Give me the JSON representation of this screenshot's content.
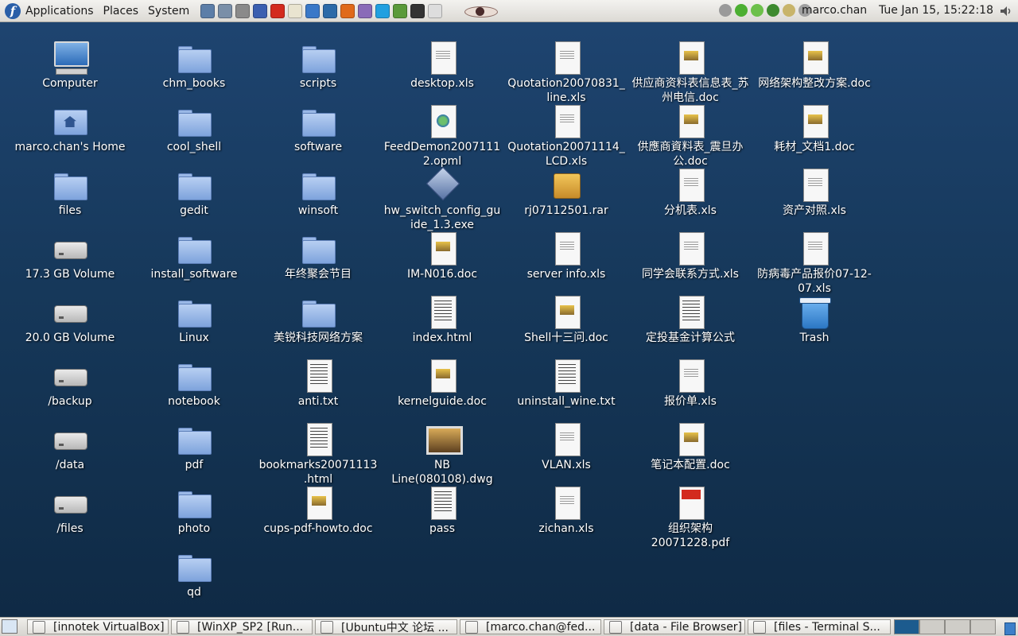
{
  "top_panel": {
    "menus": [
      "Applications",
      "Places",
      "System"
    ],
    "launchers": [
      {
        "icon": "monitor-icon",
        "color": "#5c7ea8"
      },
      {
        "icon": "network-icon",
        "color": "#7a8fa8"
      },
      {
        "icon": "server-icon",
        "color": "#8a8a8a"
      },
      {
        "icon": "globe-icon",
        "color": "#3b5fb0"
      },
      {
        "icon": "pdf-reader-icon",
        "color": "#d32a1e"
      },
      {
        "icon": "text-editor-icon",
        "color": "#e9e4d0"
      },
      {
        "icon": "chart-icon",
        "color": "#3a78c8"
      },
      {
        "icon": "thunderbird-icon",
        "color": "#2c6aa8"
      },
      {
        "icon": "firefox-icon",
        "color": "#e06a1a"
      },
      {
        "icon": "pidgin-icon",
        "color": "#8a6bb8"
      },
      {
        "icon": "skype-icon",
        "color": "#22a0e0"
      },
      {
        "icon": "dictionary-icon",
        "color": "#5a9a3a"
      },
      {
        "icon": "terminal-icon",
        "color": "#333333"
      },
      {
        "icon": "settings-icon",
        "color": "#dddddd"
      }
    ],
    "tray_icons": [
      {
        "icon": "mail-tray-icon",
        "color": "#9a9a9a"
      },
      {
        "icon": "chat-tray-icon",
        "color": "#4caf32"
      },
      {
        "icon": "status-tray-icon",
        "color": "#6cc04a"
      },
      {
        "icon": "update-tray-icon",
        "color": "#3d8a2f"
      },
      {
        "icon": "keyboard-tray-icon",
        "color": "#c8b46a"
      },
      {
        "icon": "battery-tray-icon",
        "color": "#a0a0a0"
      }
    ],
    "user": "marco.chan",
    "clock": "Tue Jan 15, 15:22:18"
  },
  "desktop": {
    "columns": [
      [
        {
          "label": "Computer",
          "type": "computer"
        },
        {
          "label": "marco.chan's Home",
          "type": "home"
        },
        {
          "label": "files",
          "type": "folder"
        },
        {
          "label": "17.3 GB Volume",
          "type": "drive"
        },
        {
          "label": "20.0 GB Volume",
          "type": "drive"
        },
        {
          "label": "/backup",
          "type": "drive"
        },
        {
          "label": "/data",
          "type": "drive"
        },
        {
          "label": "/files",
          "type": "drive"
        }
      ],
      [
        {
          "label": "chm_books",
          "type": "folder"
        },
        {
          "label": "cool_shell",
          "type": "folder"
        },
        {
          "label": "gedit",
          "type": "folder"
        },
        {
          "label": "install_software",
          "type": "folder"
        },
        {
          "label": "Linux",
          "type": "folder"
        },
        {
          "label": "notebook",
          "type": "folder"
        },
        {
          "label": "pdf",
          "type": "folder"
        },
        {
          "label": "photo",
          "type": "folder"
        },
        {
          "label": "qd",
          "type": "folder"
        }
      ],
      [
        {
          "label": "scripts",
          "type": "folder"
        },
        {
          "label": "software",
          "type": "folder"
        },
        {
          "label": "winsoft",
          "type": "folder"
        },
        {
          "label": "年终聚会节目",
          "type": "folder"
        },
        {
          "label": "美锐科技网络方案",
          "type": "folder"
        },
        {
          "label": "anti.txt",
          "type": "doc text"
        },
        {
          "label": "bookmarks20071113.html",
          "type": "doc text"
        },
        {
          "label": "cups-pdf-howto.doc",
          "type": "doc word"
        }
      ],
      [
        {
          "label": "desktop.xls",
          "type": "doc"
        },
        {
          "label": "FeedDemon20071112.opml",
          "type": "doc web"
        },
        {
          "label": "hw_switch_config_guide_1.3.exe",
          "type": "exe"
        },
        {
          "label": "IM-N016.doc",
          "type": "doc word"
        },
        {
          "label": "index.html",
          "type": "doc text"
        },
        {
          "label": "kernelguide.doc",
          "type": "doc word"
        },
        {
          "label": "NB Line(080108).dwg",
          "type": "imgfile"
        },
        {
          "label": "pass",
          "type": "doc text"
        }
      ],
      [
        {
          "label": "Quotation20070831_line.xls",
          "type": "doc"
        },
        {
          "label": "Quotation20071114_LCD.xls",
          "type": "doc"
        },
        {
          "label": "rj07112501.rar",
          "type": "archive"
        },
        {
          "label": "server info.xls",
          "type": "doc"
        },
        {
          "label": "Shell十三问.doc",
          "type": "doc word"
        },
        {
          "label": "uninstall_wine.txt",
          "type": "doc text"
        },
        {
          "label": "VLAN.xls",
          "type": "doc"
        },
        {
          "label": "zichan.xls",
          "type": "doc"
        }
      ],
      [
        {
          "label": "供应商资料表信息表_苏州电信.doc",
          "type": "doc word"
        },
        {
          "label": "供應商資料表_震旦办公.doc",
          "type": "doc word"
        },
        {
          "label": "分机表.xls",
          "type": "doc"
        },
        {
          "label": "同学会联系方式.xls",
          "type": "doc"
        },
        {
          "label": "定投基金计算公式",
          "type": "doc text"
        },
        {
          "label": "报价单.xls",
          "type": "doc"
        },
        {
          "label": "笔记本配置.doc",
          "type": "doc word"
        },
        {
          "label": "组织架构20071228.pdf",
          "type": "doc pdf"
        }
      ],
      [
        {
          "label": "网络架构整改方案.doc",
          "type": "doc word"
        },
        {
          "label": "耗材_文档1.doc",
          "type": "doc word"
        },
        {
          "label": "资产对照.xls",
          "type": "doc"
        },
        {
          "label": "防病毒产品报价07-12-07.xls",
          "type": "doc"
        },
        {
          "label": "Trash",
          "type": "trash"
        }
      ]
    ]
  },
  "taskbar": {
    "tasks": [
      {
        "label": "[innotek VirtualBox]"
      },
      {
        "label": "[WinXP_SP2 [Run..."
      },
      {
        "label": "[Ubuntu中文 论坛 ..."
      },
      {
        "label": "[marco.chan@fed..."
      },
      {
        "label": "[data - File Browser]"
      },
      {
        "label": "[files - Terminal S..."
      }
    ],
    "workspaces": 4,
    "active_workspace": 1
  }
}
